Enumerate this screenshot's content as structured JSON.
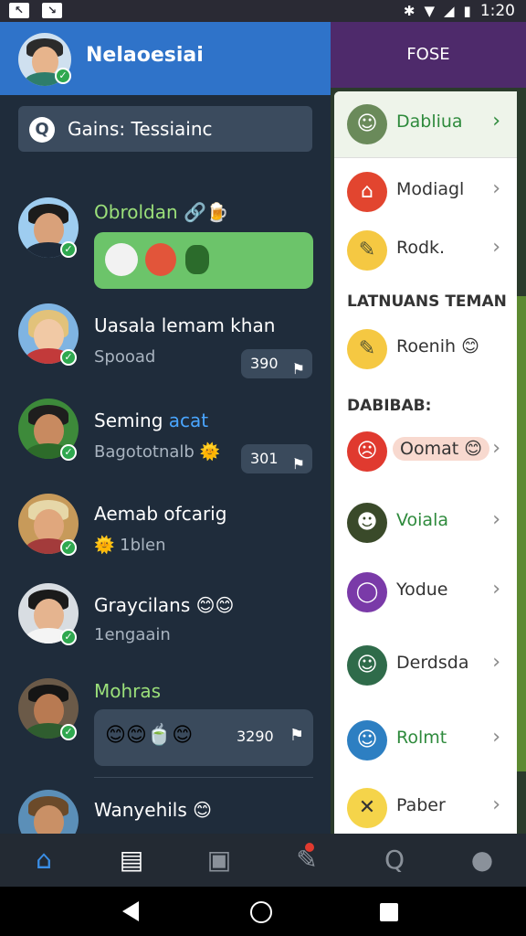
{
  "status_bar": {
    "time": "1:20"
  },
  "left": {
    "header_title": "Nelaoesiai",
    "search_text": "Gains: Tessiainc",
    "chats": [
      {
        "name": "Obroldan",
        "name_suffix": "🔗🍺",
        "subtitle": "",
        "badge": "",
        "name_color": "#9be07a"
      },
      {
        "name": "Uasala lemam khan",
        "name_suffix": "",
        "subtitle": "Spooad",
        "badge": "390"
      },
      {
        "name": "Seming",
        "name_suffix": "acat",
        "subtitle": "Bagototnalb 🌞",
        "badge": "301"
      },
      {
        "name": "Aemab ofcarig",
        "name_suffix": "",
        "subtitle": "🌞 1blen",
        "badge": ""
      },
      {
        "name": "Graycilans",
        "name_suffix": "😊😊",
        "subtitle": "1engaain",
        "badge": ""
      },
      {
        "name": "Mohras",
        "name_suffix": "",
        "subtitle": "",
        "badge": "3290",
        "name_color": "#9be07a"
      },
      {
        "name": "Wanyehils",
        "name_suffix": "😊",
        "subtitle": "",
        "badge": ""
      }
    ],
    "bubble_emojis": "😊😊🍵😊"
  },
  "right": {
    "header_title": "FOSE",
    "menu": [
      {
        "label": "Dabliua",
        "color": "#2e8a3c"
      },
      {
        "label": "Modiagl",
        "color": "#333"
      },
      {
        "label": "Rodk.",
        "color": "#333"
      }
    ],
    "section1": "LATNUANS TEMAN",
    "menu2": [
      {
        "label": "Roenih 😊",
        "color": "#333"
      }
    ],
    "section2": "DABIBAB:",
    "menu3": [
      {
        "label": "Oomat 😊",
        "color": "#333"
      },
      {
        "label": "Voiala",
        "color": "#2e8a3c"
      },
      {
        "label": "Yodue",
        "color": "#333"
      },
      {
        "label": "Derdsda",
        "color": "#333"
      },
      {
        "label": "Rolmt",
        "color": "#2e8a3c"
      },
      {
        "label": "Paber",
        "color": "#333"
      }
    ]
  },
  "colors": {
    "header_blue": "#2f73c9",
    "accent_green": "#5fc25a",
    "dark_bg": "#1f2c3b"
  }
}
